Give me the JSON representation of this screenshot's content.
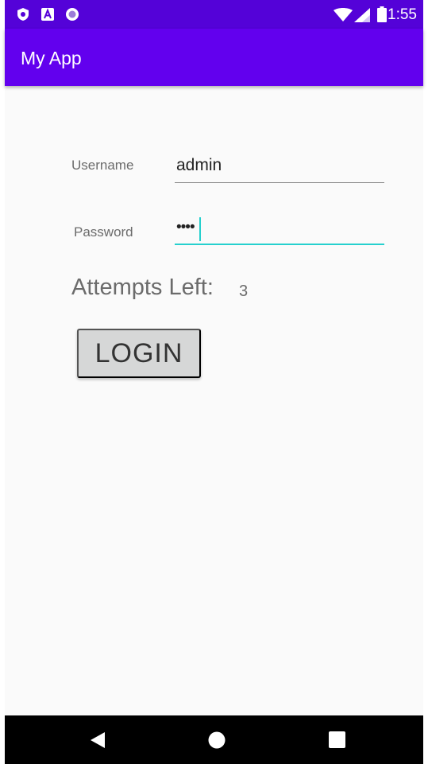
{
  "status_bar": {
    "time": "1:55",
    "icons": [
      "shield-icon",
      "font-a-icon",
      "circle-dot-icon",
      "wifi-icon",
      "signal-icon",
      "battery-icon"
    ]
  },
  "app_bar": {
    "title": "My App"
  },
  "form": {
    "username_label": "Username",
    "username_value": "admin",
    "password_label": "Password",
    "password_value": "••••",
    "attempts_label": "Attempts Left:",
    "attempts_value": "3",
    "login_label": "LOGIN"
  },
  "nav_bar": {
    "icons": [
      "back-icon",
      "home-icon",
      "recents-icon"
    ]
  },
  "colors": {
    "status_bar": "#5402d8",
    "app_bar": "#6200ee",
    "focus_accent": "#26d0ce",
    "button": "#d6d7d7"
  }
}
